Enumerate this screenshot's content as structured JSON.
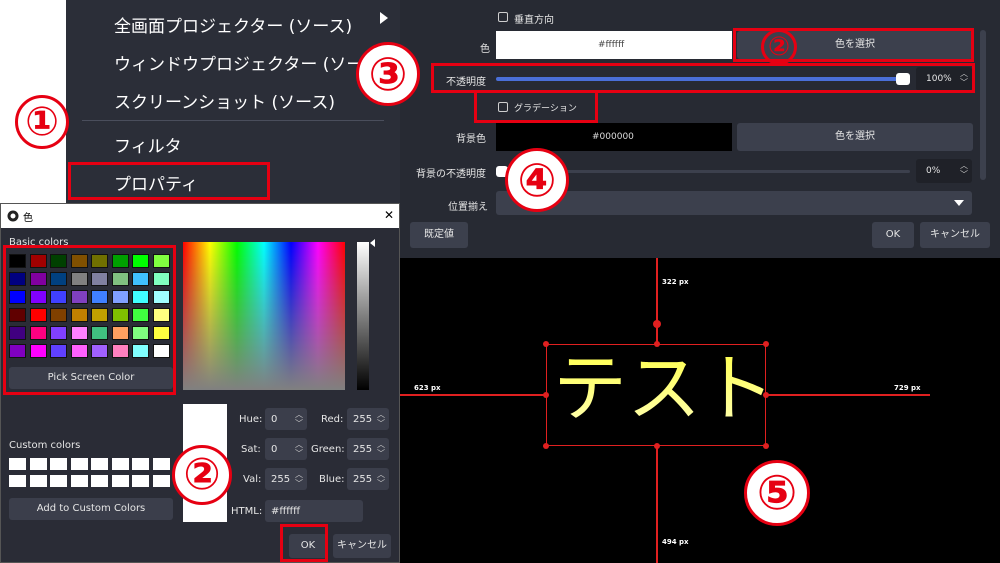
{
  "context_menu": {
    "items": [
      {
        "label": "全画面プロジェクター (ソース)",
        "has_submenu": true
      },
      {
        "label": "ウィンドウプロジェクター (ソース)"
      },
      {
        "label": "スクリーンショット (ソース)"
      },
      {
        "label": "フィルタ"
      },
      {
        "label": "プロパティ"
      }
    ]
  },
  "color_dialog": {
    "title": "色",
    "basic_colors_label": "Basic colors",
    "basic_colors": [
      "#000000",
      "#a00000",
      "#004000",
      "#805000",
      "#707000",
      "#00a000",
      "#00ff00",
      "#80ff40",
      "#000080",
      "#8000a0",
      "#004080",
      "#808080",
      "#8080a0",
      "#80c080",
      "#40c0ff",
      "#80ffc0",
      "#0000ff",
      "#8000ff",
      "#4040ff",
      "#8040c0",
      "#4080ff",
      "#80a0ff",
      "#40ffff",
      "#a0ffff",
      "#600000",
      "#ff0000",
      "#804000",
      "#c08000",
      "#c0a000",
      "#80c000",
      "#40ff40",
      "#ffff80",
      "#400080",
      "#ff0080",
      "#8040ff",
      "#ff80ff",
      "#40c080",
      "#ffa060",
      "#80ff80",
      "#ffff40",
      "#8000c0",
      "#ff00ff",
      "#6040ff",
      "#ff60ff",
      "#a060ff",
      "#ff80c0",
      "#80ffff",
      "#ffffff"
    ],
    "pick_screen_label": "Pick Screen Color",
    "custom_colors_label": "Custom colors",
    "add_custom_label": "Add to Custom Colors",
    "fields": {
      "hue_label": "Hue:",
      "hue": "0",
      "sat_label": "Sat:",
      "sat": "0",
      "val_label": "Val:",
      "val": "255",
      "red_label": "Red:",
      "red": "255",
      "green_label": "Green:",
      "green": "255",
      "blue_label": "Blue:",
      "blue": "255",
      "html_label": "HTML:",
      "html": "#ffffff"
    },
    "ok_label": "OK",
    "cancel_label": "キャンセル",
    "close_glyph": "✕"
  },
  "properties": {
    "vertical_label": "垂直方向",
    "color_label": "色",
    "color_value": "#ffffff",
    "select_color_label": "色を選択",
    "opacity_label": "不透明度",
    "opacity_value": "100%",
    "opacity_fraction": 1.0,
    "gradient_label": "グラデーション",
    "bg_color_label": "背景色",
    "bg_color_value": "#000000",
    "bg_select_color_label": "色を選択",
    "bg_opacity_label": "背景の不透明度",
    "bg_opacity_value": "0%",
    "align_label": "位置揃え",
    "defaults_label": "既定値",
    "ok_label": "OK",
    "cancel_label": "キャンセル"
  },
  "preview": {
    "text": "テスト",
    "top_px": "322 px",
    "left_px": "623 px",
    "right_px": "729 px",
    "bottom_px": "494 px"
  },
  "annotations": {
    "step1": "①",
    "step2": "②",
    "step3": "③",
    "step4": "④",
    "step5": "⑤"
  },
  "colors": {
    "annotation_red": "#e60012",
    "panel_dark": "#272a33",
    "slider_blue": "#4a6fd8"
  }
}
